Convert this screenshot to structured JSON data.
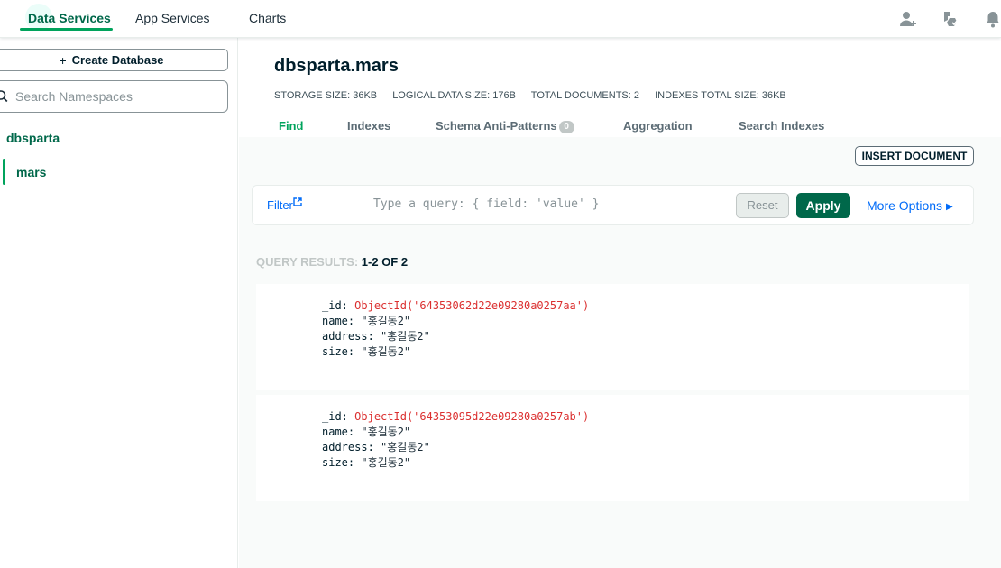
{
  "topnav": {
    "tabs": [
      "Data Services",
      "App Services",
      "Charts"
    ],
    "icons": [
      "invite-user-icon",
      "project-activity-icon",
      "notifications-icon"
    ]
  },
  "sidebar": {
    "create_database_label": "Create Database",
    "search_placeholder": "Search Namespaces",
    "database": "dbsparta",
    "collection": "mars"
  },
  "collection": {
    "title": "dbsparta.mars",
    "stats": {
      "storage": "STORAGE SIZE: 36KB",
      "logical": "LOGICAL DATA SIZE: 176B",
      "documents": "TOTAL DOCUMENTS: 2",
      "indexes": "INDEXES TOTAL SIZE: 36KB"
    },
    "tabs": [
      "Find",
      "Indexes",
      "Schema Anti-Patterns",
      "Aggregation",
      "Search Indexes"
    ],
    "schema_badge": "0",
    "active_tab": "Find"
  },
  "toolbar": {
    "insert_document_label": "INSERT DOCUMENT",
    "filter_label": "Filter",
    "query_placeholder": "Type a query: { field: 'value' }",
    "reset_label": "Reset",
    "apply_label": "Apply",
    "more_options_label": "More Options"
  },
  "results": {
    "label": "QUERY RESULTS:",
    "count": "1-2 OF 2"
  },
  "documents": [
    {
      "id_key": "_id:",
      "id_value": "ObjectId('64353062d22e09280a0257aa')",
      "name_key": "name:",
      "name_value": "\"홍길동2\"",
      "address_key": "address:",
      "address_value": "\"홍길동2\"",
      "size_key": "size:",
      "size_value": "\"홍길동2\""
    },
    {
      "id_key": "_id:",
      "id_value": "ObjectId('64353095d22e09280a0257ab')",
      "name_key": "name:",
      "name_value": "\"홍길동2\"",
      "address_key": "address:",
      "address_value": "\"홍길동2\"",
      "size_key": "size:",
      "size_value": "\"홍길동2\""
    }
  ],
  "colors": {
    "brand_green": "#00684a",
    "accent_green": "#00a35c",
    "link_blue": "#016bf8",
    "objectid_red": "#db3030"
  }
}
